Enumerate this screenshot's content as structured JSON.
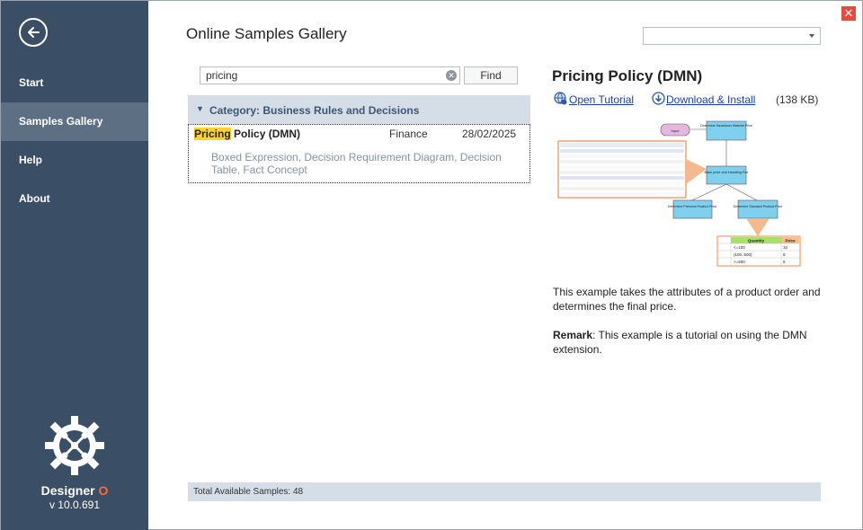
{
  "sidebar": {
    "items": [
      {
        "label": "Start"
      },
      {
        "label": "Samples Gallery"
      },
      {
        "label": "Help"
      },
      {
        "label": "About"
      }
    ],
    "brand_name": "Designer",
    "brand_suffix": "O",
    "version": "v 10.0.691"
  },
  "header": {
    "title": "Online Samples Gallery",
    "dropdown_value": ""
  },
  "search": {
    "value": "pricing",
    "find_label": "Find"
  },
  "results": {
    "category_label": "Category: Business Rules and Decisions",
    "items": [
      {
        "title_highlight": "Pricing",
        "title_rest": " Policy (DMN)",
        "category": "Finance",
        "date": "28/02/2025",
        "tags": "Boxed Expression, Decision Requirement Diagram, Decision Table, Fact Concept"
      }
    ],
    "status": "Total Available Samples: 48"
  },
  "detail": {
    "title": "Pricing Policy (DMN)",
    "open_tutorial_label": "Open Tutorial",
    "download_label": "Download & Install",
    "size": "(138 KB)",
    "description": "This example takes the attributes of a product order and determines the final price.",
    "remark_label": "Remark",
    "remark_text": ": This example is a tutorial on using the DMN extension.",
    "preview": {
      "input_label": "Input",
      "node_top": "Determine Hazardous Material Price",
      "node_mid": "Base price and Handling Fee",
      "node_left": "Determine Premium Product Price",
      "node_right": "Determine Standard Product Price",
      "table_col1": "Quantity",
      "table_col2": "Price",
      "table_rows": [
        [
          "<=100",
          "10"
        ],
        [
          "(100..500)",
          "9"
        ],
        [
          ">=500",
          "8"
        ]
      ]
    }
  },
  "colors": {
    "sidebar": "#3a4e65",
    "sidebar_active": "#5d6f83",
    "accent_orange": "#ff6a2b",
    "highlight": "#ffd32a",
    "category_bar": "#d5dde7",
    "link": "#1a3fae",
    "close": "#e74a3b"
  },
  "icons": [
    "back-arrow-icon",
    "close-icon",
    "clear-icon",
    "globe-icon",
    "download-icon",
    "designer-logo-icon"
  ]
}
